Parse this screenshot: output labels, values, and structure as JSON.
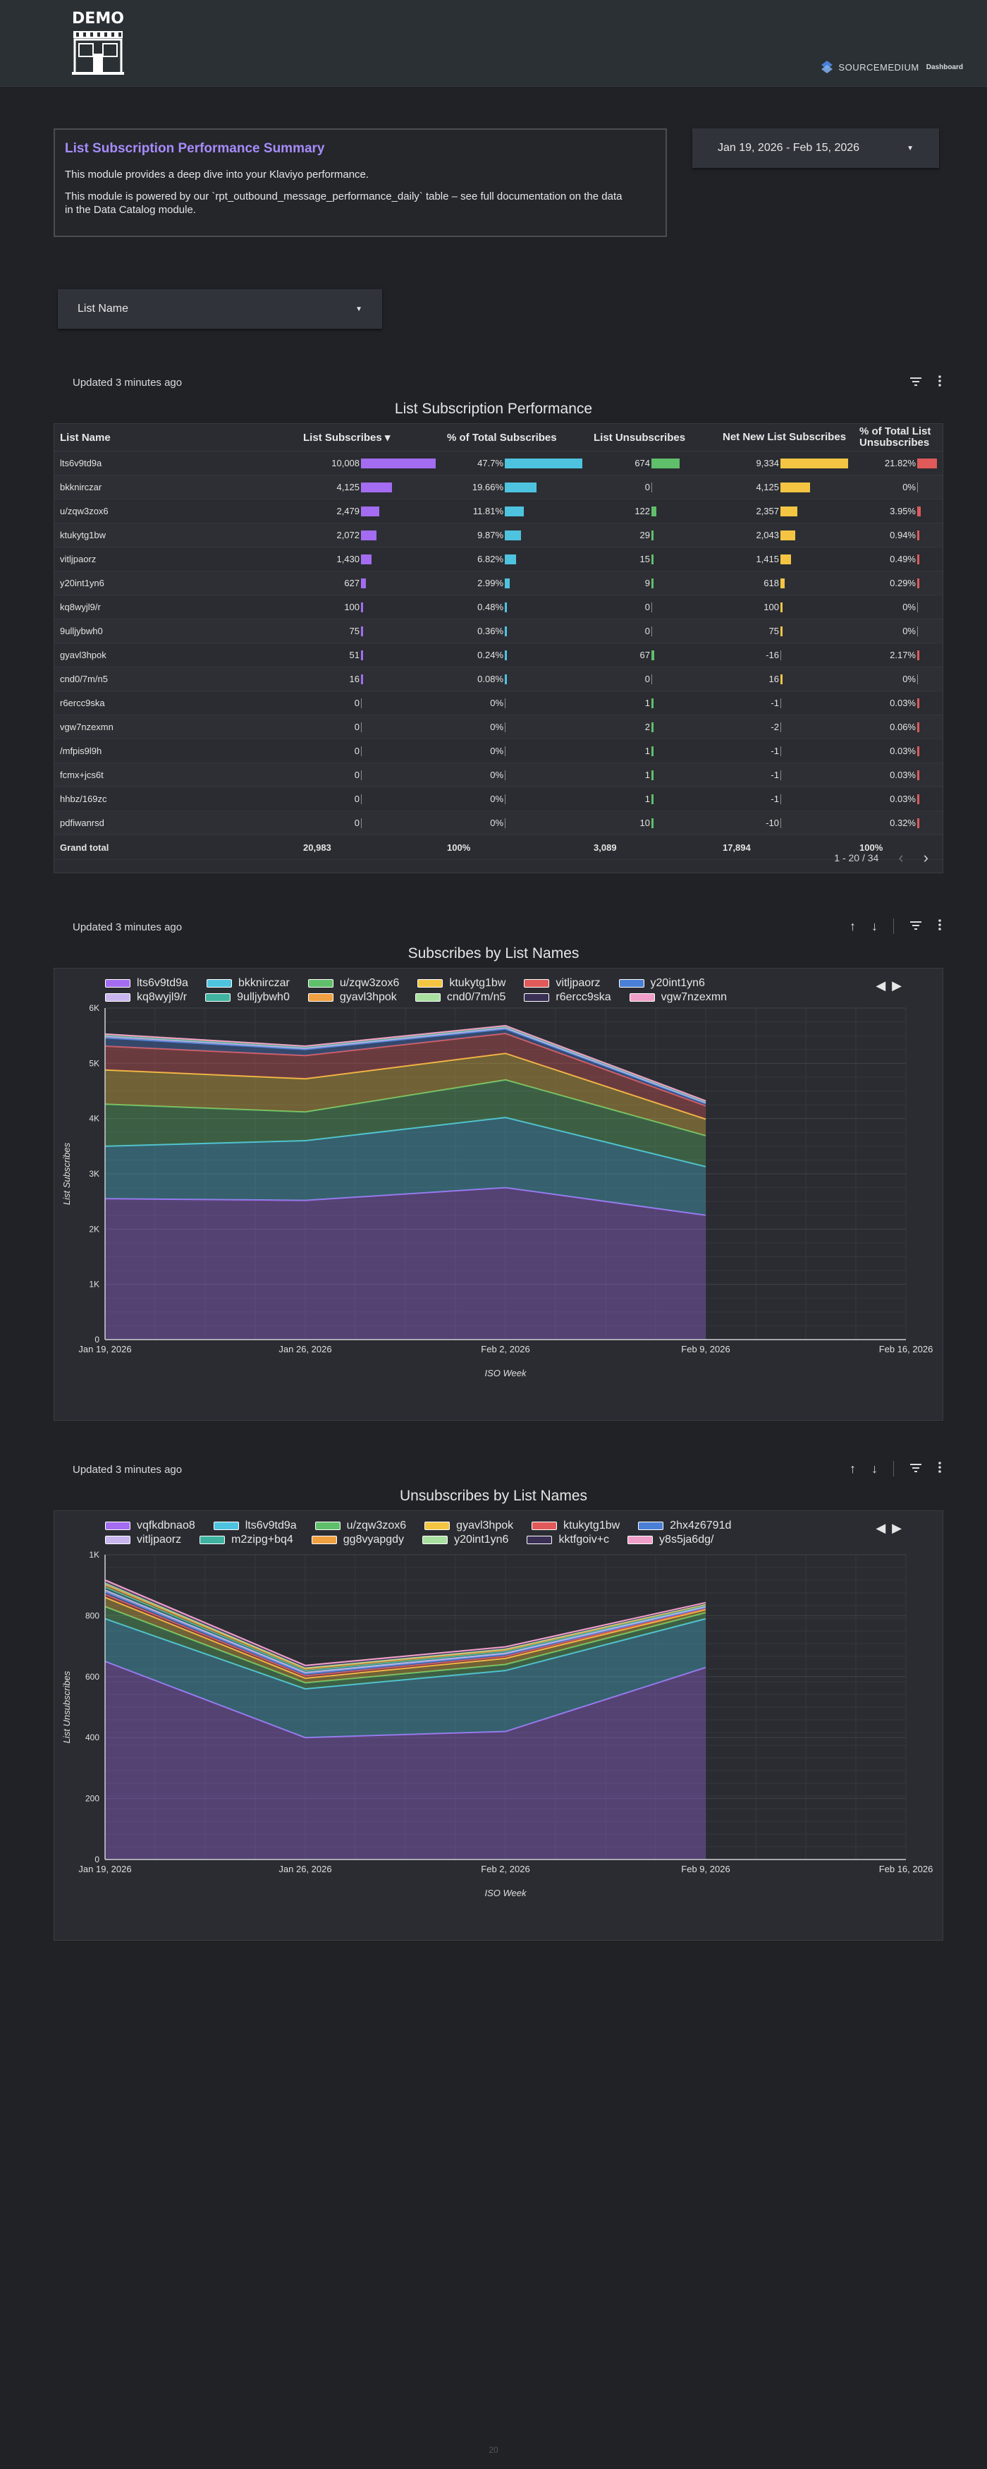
{
  "header": {
    "logo_text": "DEMO",
    "brand": "SOURCEMEDIUM",
    "brand_suffix": "Dashboard"
  },
  "summary": {
    "title": "List Subscription Performance Summary",
    "p1": "This module provides a deep dive into your Klaviyo performance.",
    "p2": "This module is powered by our `rpt_outbound_message_performance_daily` table – see full documentation on the data in the Data Catalog module."
  },
  "date_range": "Jan 19, 2026 - Feb 15, 2026",
  "filter_label": "List Name",
  "updated": "Updated 3 minutes ago",
  "table": {
    "title": "List Subscription Performance",
    "columns": [
      "List Name",
      "List Subscribes ▾",
      "% of Total Subscribes",
      "List Unsubscribes",
      "Net New List Subscribes",
      "% of Total List Unsubscribes"
    ],
    "rows": [
      [
        "lts6v9td9a",
        "10,008",
        "47.7%",
        "674",
        "9,334",
        "21.82%"
      ],
      [
        "bkknirczar",
        "4,125",
        "19.66%",
        "0",
        "4,125",
        "0%"
      ],
      [
        "u/zqw3zox6",
        "2,479",
        "11.81%",
        "122",
        "2,357",
        "3.95%"
      ],
      [
        "ktukytg1bw",
        "2,072",
        "9.87%",
        "29",
        "2,043",
        "0.94%"
      ],
      [
        "vitljpaorz",
        "1,430",
        "6.82%",
        "15",
        "1,415",
        "0.49%"
      ],
      [
        "y20int1yn6",
        "627",
        "2.99%",
        "9",
        "618",
        "0.29%"
      ],
      [
        "kq8wyjl9/r",
        "100",
        "0.48%",
        "0",
        "100",
        "0%"
      ],
      [
        "9ulljybwh0",
        "75",
        "0.36%",
        "0",
        "75",
        "0%"
      ],
      [
        "gyavl3hpok",
        "51",
        "0.24%",
        "67",
        "-16",
        "2.17%"
      ],
      [
        "cnd0/7m/n5",
        "16",
        "0.08%",
        "0",
        "16",
        "0%"
      ],
      [
        "r6ercc9ska",
        "0",
        "0%",
        "1",
        "-1",
        "0.03%"
      ],
      [
        "vgw7nzexmn",
        "0",
        "0%",
        "2",
        "-2",
        "0.06%"
      ],
      [
        "/mfpis9l9h",
        "0",
        "0%",
        "1",
        "-1",
        "0.03%"
      ],
      [
        "fcmx+jcs6t",
        "0",
        "0%",
        "1",
        "-1",
        "0.03%"
      ],
      [
        "hhbz/169zc",
        "0",
        "0%",
        "1",
        "-1",
        "0.03%"
      ],
      [
        "pdfiwanrsd",
        "0",
        "0%",
        "10",
        "-10",
        "0.32%"
      ]
    ],
    "grand_total": [
      "Grand total",
      "20,983",
      "100%",
      "3,089",
      "17,894",
      "100%"
    ],
    "pager": "1 - 20 / 34"
  },
  "colors": {
    "subs_bar": "#a46cf0",
    "pct_bar": "#4ec3e0",
    "unsub_bar": "#5fbf6a",
    "net_bar": "#f4c542",
    "pct_unsub_bar": "#e05a5a"
  },
  "chart_data": [
    {
      "type": "area",
      "title": "Subscribes by List Names",
      "xlabel": "ISO Week",
      "ylabel": "List Subscribes",
      "x": [
        "Jan 19, 2026",
        "Jan 26, 2026",
        "Feb 2, 2026",
        "Feb 9, 2026",
        "Feb 16, 2026"
      ],
      "yticks": [
        "0",
        "1K",
        "2K",
        "3K",
        "4K",
        "5K",
        "6K"
      ],
      "ylim": [
        0,
        6000
      ],
      "series": [
        {
          "name": "lts6v9td9a",
          "color": "#a46cf0",
          "values": [
            2550,
            2520,
            2750,
            2250
          ]
        },
        {
          "name": "bkknirczar",
          "color": "#4ec3e0",
          "values": [
            950,
            1080,
            1270,
            880
          ]
        },
        {
          "name": "u/zqw3zox6",
          "color": "#5fbf6a",
          "values": [
            760,
            520,
            680,
            560
          ]
        },
        {
          "name": "ktukytg1bw",
          "color": "#f4c542",
          "values": [
            620,
            600,
            480,
            300
          ]
        },
        {
          "name": "vitljpaorz",
          "color": "#e05a5a",
          "values": [
            430,
            420,
            360,
            240
          ]
        },
        {
          "name": "y20int1yn6",
          "color": "#4a7fd6",
          "values": [
            150,
            110,
            80,
            40
          ]
        },
        {
          "name": "kq8wyjl9/r",
          "color": "#c9b6ef",
          "values": [
            30,
            25,
            25,
            20
          ]
        },
        {
          "name": "9ulljybwh0",
          "color": "#3fb3a0",
          "values": [
            20,
            20,
            20,
            15
          ]
        },
        {
          "name": "gyavl3hpok",
          "color": "#f0a040",
          "values": [
            15,
            12,
            12,
            12
          ]
        },
        {
          "name": "cnd0/7m/n5",
          "color": "#a8e0a0",
          "values": [
            5,
            4,
            4,
            3
          ]
        },
        {
          "name": "r6ercc9ska",
          "color": "#3a2f55",
          "values": [
            0,
            0,
            0,
            0
          ]
        },
        {
          "name": "vgw7nzexmn",
          "color": "#f0a0c8",
          "values": [
            0,
            0,
            0,
            0
          ]
        }
      ]
    },
    {
      "type": "area",
      "title": "Unsubscribes by List Names",
      "xlabel": "ISO Week",
      "ylabel": "List Unsubscribes",
      "x": [
        "Jan 19, 2026",
        "Jan 26, 2026",
        "Feb 2, 2026",
        "Feb 9, 2026",
        "Feb 16, 2026"
      ],
      "yticks": [
        "0",
        "200",
        "400",
        "600",
        "800",
        "1K"
      ],
      "ylim": [
        0,
        1000
      ],
      "series": [
        {
          "name": "vqfkdbnao8",
          "color": "#a46cf0",
          "values": [
            650,
            400,
            420,
            630
          ]
        },
        {
          "name": "lts6v9td9a",
          "color": "#4ec3e0",
          "values": [
            140,
            160,
            200,
            160
          ]
        },
        {
          "name": "u/zqw3zox6",
          "color": "#5fbf6a",
          "values": [
            40,
            20,
            20,
            20
          ]
        },
        {
          "name": "gyavl3hpok",
          "color": "#f4c542",
          "values": [
            30,
            15,
            20,
            10
          ]
        },
        {
          "name": "ktukytg1bw",
          "color": "#e05a5a",
          "values": [
            10,
            8,
            7,
            4
          ]
        },
        {
          "name": "2hx4z6791d",
          "color": "#4a7fd6",
          "values": [
            8,
            6,
            6,
            3
          ]
        },
        {
          "name": "vitljpaorz",
          "color": "#c9b6ef",
          "values": [
            6,
            5,
            4,
            3
          ]
        },
        {
          "name": "m2zipg+bq4",
          "color": "#3fb3a0",
          "values": [
            10,
            6,
            6,
            4
          ]
        },
        {
          "name": "gg8vyapgdy",
          "color": "#f0a040",
          "values": [
            8,
            6,
            5,
            3
          ]
        },
        {
          "name": "y20int1yn6",
          "color": "#a8e0a0",
          "values": [
            6,
            4,
            4,
            2
          ]
        },
        {
          "name": "kktfgoiv+c",
          "color": "#3a2f55",
          "values": [
            4,
            3,
            3,
            2
          ]
        },
        {
          "name": "y8s5ja6dg/",
          "color": "#f0a0c8",
          "values": [
            5,
            4,
            3,
            2
          ]
        }
      ]
    }
  ],
  "page_number": "20"
}
